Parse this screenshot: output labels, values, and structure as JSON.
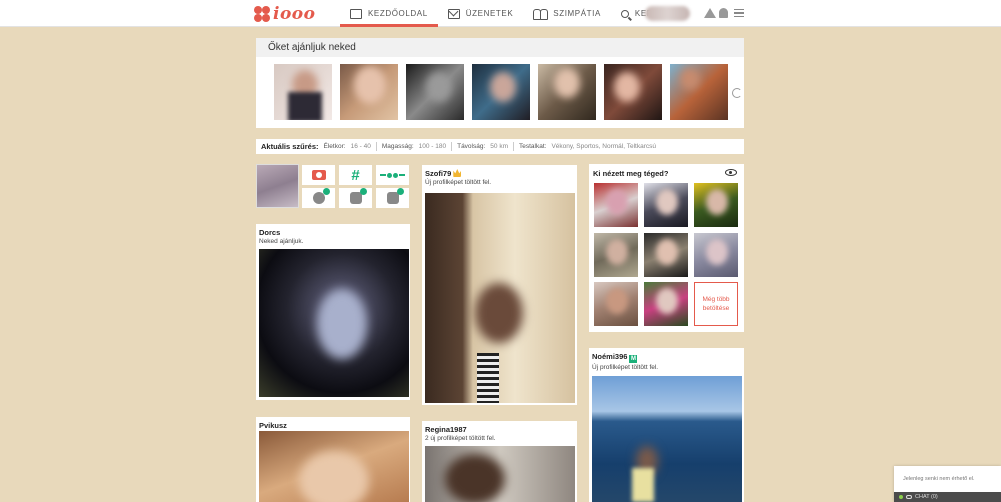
{
  "app": {
    "logo_text": "iooo"
  },
  "nav": {
    "items": [
      {
        "label": "KEZDŐOLDAL",
        "icon": "newspaper-icon",
        "active": true
      },
      {
        "label": "ÜZENETEK",
        "icon": "mail-icon"
      },
      {
        "label": "SZIMPÁTIA",
        "icon": "people-icon"
      },
      {
        "label": "KERESÉS",
        "icon": "search-icon"
      }
    ]
  },
  "recommend": {
    "title": "Őket ajánljuk neked"
  },
  "filter": {
    "title": "Aktuális szűrés:",
    "age_label": "Életkor:",
    "age_value": "16 - 40",
    "height_label": "Magasság:",
    "height_value": "100 - 180",
    "distance_label": "Távolság:",
    "distance_value": "50 km",
    "body_label": "Testalkat:",
    "body_value": "Vékony, Sportos, Normál, Teltkarcsú"
  },
  "cards": {
    "dorcs": {
      "name": "Dorcs",
      "sub": "Neked ajánljuk."
    },
    "pvikusz": {
      "name": "Pvikusz"
    },
    "szofi": {
      "name": "Szofi79",
      "sub": "Új profilképet töltött fel."
    },
    "regina": {
      "name": "Regina1987",
      "sub": "2 új profilképet töltött fel."
    },
    "noemi": {
      "name": "Noémi396",
      "badge": "M",
      "sub": "Új profilképet töltött fel."
    }
  },
  "viewed": {
    "title": "Ki nézett meg téged?",
    "load_more": "Még több betöltése"
  },
  "chat": {
    "message": "Jelenleg senki nem érhető el.",
    "label": "CHAT (0)"
  },
  "colors": {
    "accent": "#e45a4c",
    "green": "#1bb07a",
    "background": "#e8d9bb"
  }
}
